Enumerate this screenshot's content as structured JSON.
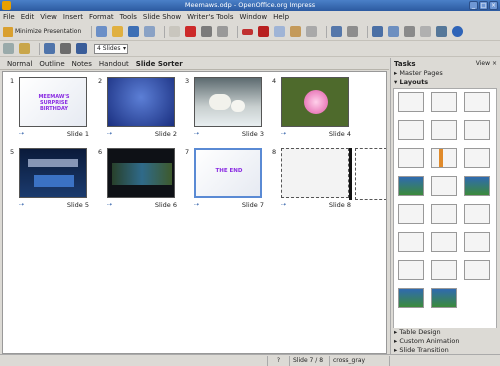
{
  "window": {
    "title": "Meemaws.odp - OpenOffice.org Impress"
  },
  "menu": [
    "File",
    "Edit",
    "View",
    "Insert",
    "Format",
    "Tools",
    "Slide Show",
    "Writer's Tools",
    "Window",
    "Help"
  ],
  "toolbar": {
    "minimize_presentation": "Minimize Presentation",
    "slides_per_row": "4 Slides"
  },
  "view_tabs": [
    "Normal",
    "Outline",
    "Notes",
    "Handout",
    "Slide Sorter"
  ],
  "active_view": "Slide Sorter",
  "slides": [
    {
      "num": "1",
      "label": "Slide 1",
      "title": "MEEMAW'S SURPRISE BIRTHDAY"
    },
    {
      "num": "2",
      "label": "Slide 2"
    },
    {
      "num": "3",
      "label": "Slide 3"
    },
    {
      "num": "4",
      "label": "Slide 4"
    },
    {
      "num": "5",
      "label": "Slide 5"
    },
    {
      "num": "6",
      "label": "Slide 6"
    },
    {
      "num": "7",
      "label": "Slide 7",
      "title": "THE END"
    },
    {
      "num": "8",
      "label": "Slide 8"
    }
  ],
  "tasks": {
    "title": "Tasks",
    "view_label": "View",
    "sections_top": [
      "Master Pages",
      "Layouts"
    ],
    "sections_bottom": [
      "Table Design",
      "Custom Animation",
      "Slide Transition"
    ]
  },
  "status": {
    "slide": "Slide 7 / 8",
    "master": "cross_gray"
  }
}
